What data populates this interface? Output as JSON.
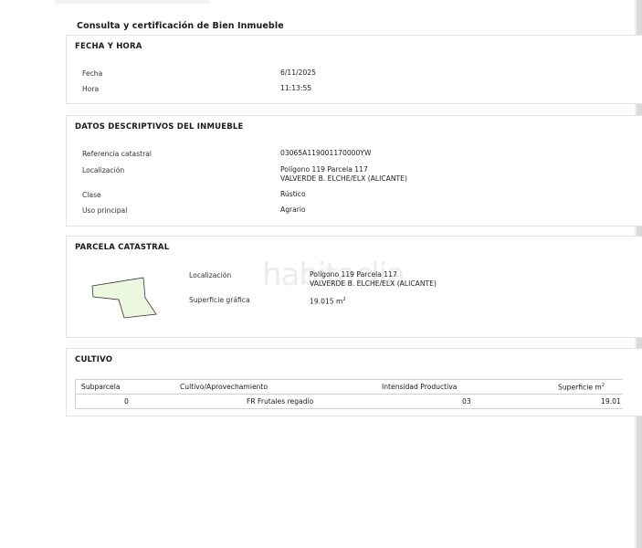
{
  "document": {
    "title": "Consulta y certificación de Bien Inmueble"
  },
  "fecha_hora": {
    "title": "FECHA Y HORA",
    "fecha_label": "Fecha",
    "fecha_value": "6/11/2025",
    "hora_label": "Hora",
    "hora_value": "11:13:55"
  },
  "datos": {
    "title": "DATOS DESCRIPTIVOS DEL INMUEBLE",
    "referencia_label": "Referencia catastral",
    "referencia_value": "03065A119001170000YW",
    "localizacion_label": "Localización",
    "localizacion_line1": "Polígono 119 Parcela 117",
    "localizacion_line2": "VALVERDE B. ELCHE/ELX (ALICANTE)",
    "clase_label": "Clase",
    "clase_value": "Rústico",
    "uso_label": "Uso principal",
    "uso_value": "Agrario"
  },
  "parcela": {
    "title": "PARCELA CATASTRAL",
    "localizacion_label": "Localización",
    "localizacion_line1": "Polígono 119 Parcela 117",
    "localizacion_line2": "VALVERDE B. ELCHE/ELX (ALICANTE)",
    "superficie_label": "Superficie gráfica",
    "superficie_value": "19.015 m",
    "superficie_sup": "2",
    "shape_fill": "#ecf7df",
    "watermark": "habitaclia"
  },
  "cultivo": {
    "title": "CULTIVO",
    "headers": {
      "subparcela": "Subparcela",
      "cultivo": "Cultivo/Aprovechamiento",
      "intensidad": "Intensidad Productiva",
      "superficie": "Superficie m",
      "superficie_sup": "2"
    },
    "rows": [
      {
        "subparcela": "0",
        "cultivo": "FR Frutales regadío",
        "intensidad": "03",
        "superficie": "19.01"
      }
    ]
  }
}
